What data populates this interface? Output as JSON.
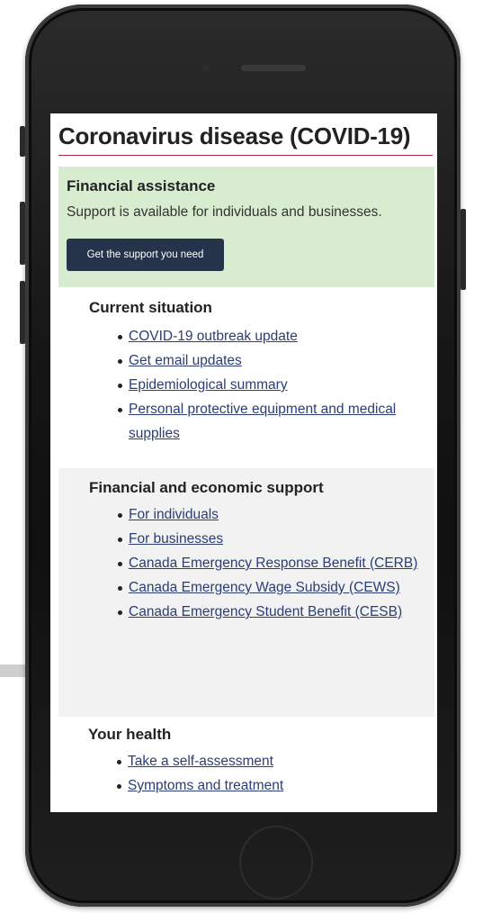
{
  "page": {
    "title": "Coronavirus disease (COVID-19)"
  },
  "alert": {
    "heading": "Financial assistance",
    "text": "Support is available for individuals and businesses.",
    "button_label": "Get the support you need"
  },
  "current_situation": {
    "heading": "Current situation",
    "links": [
      "COVID-19 outbreak update",
      "Get email updates",
      "Epidemiological summary",
      "Personal protective equipment and medical supplies"
    ]
  },
  "financial_support": {
    "heading": "Financial and economic support",
    "links": [
      "For individuals",
      "For businesses",
      "Canada Emergency Response Benefit (CERB)",
      "Canada Emergency Wage Subsidy (CEWS)",
      "Canada Emergency Student Benefit (CESB)"
    ]
  },
  "your_health": {
    "heading": "Your health",
    "links": [
      "Take a self-assessment",
      "Symptoms and treatment"
    ]
  },
  "colors": {
    "accent_rule": "#b2263d",
    "alert_bg": "#d8ecd0",
    "button_bg": "#25344a",
    "link": "#2b3e73",
    "section_bg": "#f2f2f2"
  }
}
